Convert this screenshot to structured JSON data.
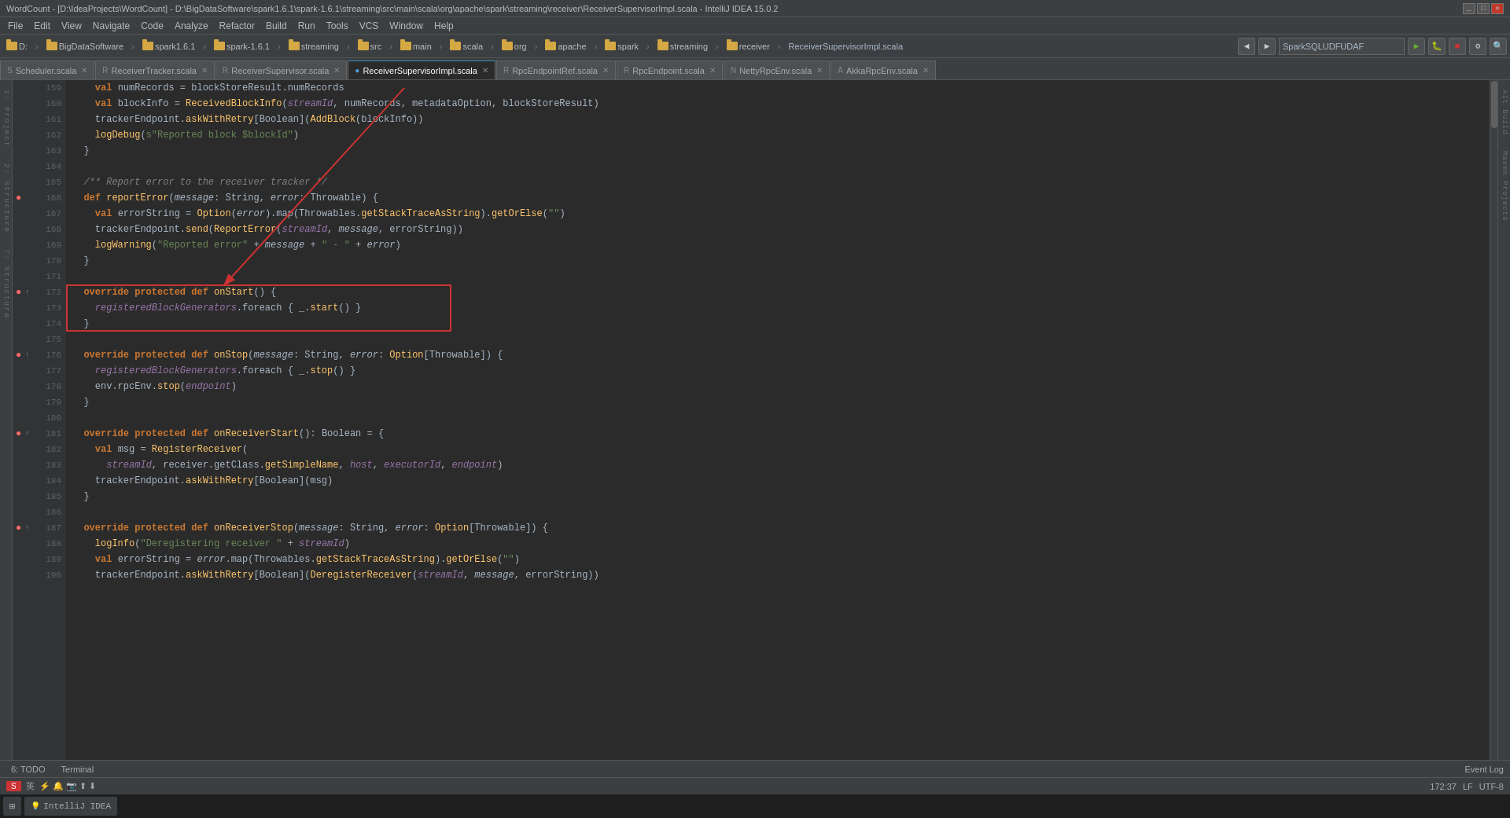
{
  "titleBar": {
    "title": "WordCount - [D:\\IdeaProjects\\WordCount] - D:\\BigDataSoftware\\spark1.6.1\\spark-1.6.1\\streaming\\src\\main\\scala\\org\\apache\\spark\\streaming\\receiver\\ReceiverSupervisorImpl.scala - IntelliJ IDEA 15.0.2",
    "controls": [
      "_",
      "□",
      "✕"
    ]
  },
  "menuBar": {
    "items": [
      "File",
      "Edit",
      "View",
      "Navigate",
      "Code",
      "Analyze",
      "Refactor",
      "Build",
      "Run",
      "Tools",
      "VCS",
      "Window",
      "Help"
    ]
  },
  "toolbar": {
    "breadcrumbs": [
      "D:",
      "BigDataSoftware",
      "spark1.6.1",
      "spark-1.6.1",
      "streaming",
      "src",
      "main",
      "scala",
      "org",
      "apache",
      "spark",
      "streaming",
      "receiver",
      "ReceiverSupervisorImpl.scala"
    ],
    "searchPlaceholder": "SparkSQLUDFUDAF"
  },
  "tabs": [
    {
      "label": "Scheduler.scala",
      "active": false,
      "hasClose": true
    },
    {
      "label": "ReceiverTracker.scala",
      "active": false,
      "hasClose": true
    },
    {
      "label": "ReceiverSupervisor.scala",
      "active": false,
      "hasClose": true
    },
    {
      "label": "ReceiverSupervisorImpl.scala",
      "active": true,
      "hasClose": true
    },
    {
      "label": "RpcEndpointRef.scala",
      "active": false,
      "hasClose": true
    },
    {
      "label": "RpcEndpoint.scala",
      "active": false,
      "hasClose": true
    },
    {
      "label": "NettyRpcEnv.scala",
      "active": false,
      "hasClose": true
    },
    {
      "label": "AkkaRpcEnv.scala",
      "active": false,
      "hasClose": true
    }
  ],
  "codeLines": [
    {
      "num": 159,
      "content": "    val numRecords = blockStoreResult.numRecords",
      "type": "normal"
    },
    {
      "num": 160,
      "content": "    val blockInfo = ReceivedBlockInfo(streamId, numRecords, metadataOption, blockStoreResult)",
      "type": "normal"
    },
    {
      "num": 161,
      "content": "    trackerEndpoint.askWithRetry[Boolean](AddBlock(blockInfo))",
      "type": "normal"
    },
    {
      "num": 162,
      "content": "    logDebug(s\"Reported block $blockId\")",
      "type": "normal"
    },
    {
      "num": 163,
      "content": "  }",
      "type": "normal"
    },
    {
      "num": 164,
      "content": "",
      "type": "normal"
    },
    {
      "num": 165,
      "content": "  /** Report error to the receiver tracker */",
      "type": "comment"
    },
    {
      "num": 166,
      "content": "  def reportError(message: String, error: Throwable) {",
      "type": "normal"
    },
    {
      "num": 167,
      "content": "    val errorString = Option(error).map(Throwables.getStackTraceAsString).getOrElse(\"\")",
      "type": "normal"
    },
    {
      "num": 168,
      "content": "    trackerEndpoint.send(ReportError(streamId, message, errorString))",
      "type": "normal"
    },
    {
      "num": 169,
      "content": "    logWarning(\"Reported error\" + message + \" - \" + error)",
      "type": "normal"
    },
    {
      "num": 170,
      "content": "  }",
      "type": "normal"
    },
    {
      "num": 171,
      "content": "",
      "type": "normal"
    },
    {
      "num": 172,
      "content": "  override protected def onStart() {",
      "type": "highlighted"
    },
    {
      "num": 173,
      "content": "    registeredBlockGenerators.foreach { _.start() }",
      "type": "highlighted"
    },
    {
      "num": 174,
      "content": "  }",
      "type": "highlighted"
    },
    {
      "num": 175,
      "content": "",
      "type": "normal"
    },
    {
      "num": 176,
      "content": "  override protected def onStop(message: String, error: Option[Throwable]) {",
      "type": "normal"
    },
    {
      "num": 177,
      "content": "    registeredBlockGenerators.foreach { _.stop() }",
      "type": "normal"
    },
    {
      "num": 178,
      "content": "    env.rpcEnv.stop(endpoint)",
      "type": "normal"
    },
    {
      "num": 179,
      "content": "  }",
      "type": "normal"
    },
    {
      "num": 180,
      "content": "",
      "type": "normal"
    },
    {
      "num": 181,
      "content": "  override protected def onReceiverStart(): Boolean = {",
      "type": "normal"
    },
    {
      "num": 182,
      "content": "    val msg = RegisterReceiver(",
      "type": "normal"
    },
    {
      "num": 183,
      "content": "      streamId, receiver.getClass.getSimpleName, host, executorId, endpoint)",
      "type": "normal"
    },
    {
      "num": 184,
      "content": "    trackerEndpoint.askWithRetry[Boolean](msg)",
      "type": "normal"
    },
    {
      "num": 185,
      "content": "  }",
      "type": "normal"
    },
    {
      "num": 186,
      "content": "",
      "type": "normal"
    },
    {
      "num": 187,
      "content": "  override protected def onReceiverStop(message: String, error: Option[Throwable]) {",
      "type": "normal"
    },
    {
      "num": 188,
      "content": "    logInfo(\"Deregistering receiver \" + streamId)",
      "type": "normal"
    },
    {
      "num": 189,
      "content": "    val errorString = error.map(Throwables.getStackTraceAsString).getOrElse(\"\")",
      "type": "normal"
    },
    {
      "num": 190,
      "content": "    trackerEndpoint.askWithRetry[Boolean](DeregisterReceiver(streamId, message, errorString))",
      "type": "normal"
    }
  ],
  "statusBar": {
    "left": [
      "6: TODO",
      "Terminal"
    ],
    "position": "172:37",
    "lineEnding": "LF",
    "encoding": "UTF-8",
    "rightItems": [
      "Event Log"
    ]
  },
  "colors": {
    "keyword": "#cc7832",
    "function": "#ffc66d",
    "string": "#6a8759",
    "comment": "#808080",
    "variable": "#9876aa",
    "number": "#6897bb",
    "highlight_bg": "#374447",
    "accent": "#3d8fbd",
    "annotation_red": "#cc3333"
  }
}
